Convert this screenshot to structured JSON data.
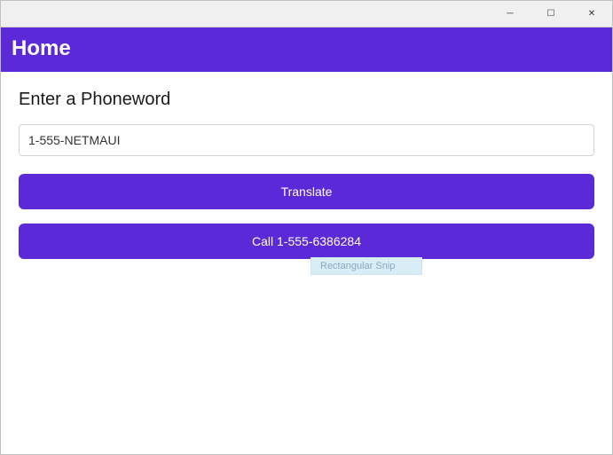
{
  "titlebar": {
    "minimize": "─",
    "maximize": "☐",
    "close": "✕"
  },
  "header": {
    "title": "Home"
  },
  "main": {
    "label": "Enter a Phoneword",
    "input_value": "1-555-NETMAUI",
    "translate_button": "Translate",
    "call_button": "Call 1-555-6386284"
  },
  "snip": {
    "text": "Rectangular Snip"
  },
  "colors": {
    "accent": "#5b29d8"
  }
}
